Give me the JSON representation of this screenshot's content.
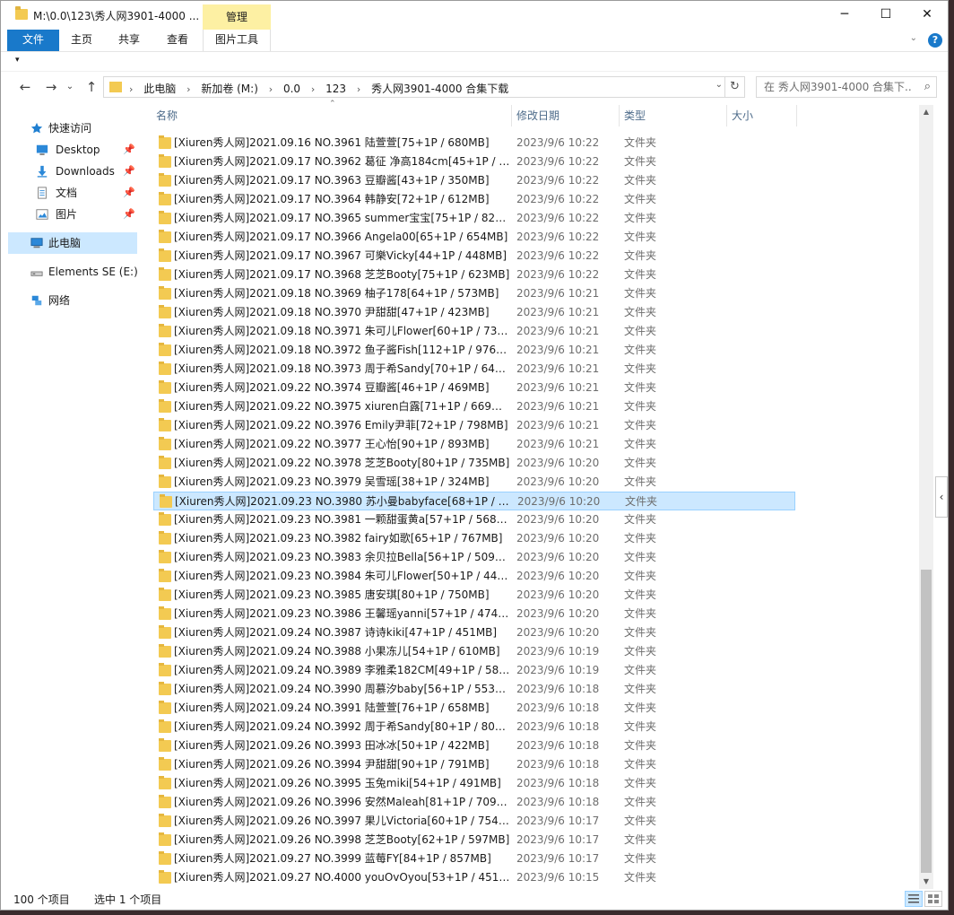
{
  "window": {
    "title": "M:\\0.0\\123\\秀人网3901-4000 ...",
    "context_tab_header": "管理",
    "minimize_glyph": "─",
    "maximize_glyph": "☐",
    "close_glyph": "✕"
  },
  "ribbon": {
    "tabs": [
      "文件",
      "主页",
      "共享",
      "查看",
      "图片工具"
    ],
    "expand_glyph": "⌄",
    "help_glyph": "?"
  },
  "qat": {
    "glyph": "▾"
  },
  "nav_buttons": {
    "back": "←",
    "forward": "→",
    "recent": "⌄",
    "up": "↑"
  },
  "address": {
    "crumbs": [
      "此电脑",
      "新加卷 (M:)",
      "0.0",
      "123",
      "秀人网3901-4000 合集下载"
    ],
    "separator": "›",
    "dropdown_glyph": "⌄",
    "refresh_glyph": "↻"
  },
  "search": {
    "placeholder": "在 秀人网3901-4000 合集下...",
    "icon": "⌕"
  },
  "nav_pane": [
    {
      "label": "快速访问",
      "icon": "star-icon",
      "pinned": false,
      "selected": false
    },
    {
      "label": "Desktop",
      "icon": "desktop-icon",
      "pinned": true,
      "selected": false
    },
    {
      "label": "Downloads",
      "icon": "download-icon",
      "pinned": true,
      "selected": false
    },
    {
      "label": "文档",
      "icon": "document-icon",
      "pinned": true,
      "selected": false
    },
    {
      "label": "图片",
      "icon": "picture-icon",
      "pinned": true,
      "selected": false
    },
    {
      "label": "此电脑",
      "icon": "computer-icon",
      "pinned": false,
      "selected": true
    },
    {
      "label": "Elements SE (E:)",
      "icon": "drive-icon",
      "pinned": false,
      "selected": false
    },
    {
      "label": "网络",
      "icon": "network-icon",
      "pinned": false,
      "selected": false
    }
  ],
  "columns": {
    "name": "名称",
    "date": "修改日期",
    "type": "类型",
    "size": "大小"
  },
  "rows": [
    {
      "name": "[Xiuren秀人网]2021.09.16 NO.3961 陆萱萱[75+1P / 680MB]",
      "date": "2023/9/6 10:22",
      "type": "文件夹"
    },
    {
      "name": "[Xiuren秀人网]2021.09.17 NO.3962 葛征 净高184cm[45+1P / 50...",
      "date": "2023/9/6 10:22",
      "type": "文件夹"
    },
    {
      "name": "[Xiuren秀人网]2021.09.17 NO.3963 豆瓣酱[43+1P / 350MB]",
      "date": "2023/9/6 10:22",
      "type": "文件夹"
    },
    {
      "name": "[Xiuren秀人网]2021.09.17 NO.3964 韩静安[72+1P / 612MB]",
      "date": "2023/9/6 10:22",
      "type": "文件夹"
    },
    {
      "name": "[Xiuren秀人网]2021.09.17 NO.3965 summer宝宝[75+1P / 823M...",
      "date": "2023/9/6 10:22",
      "type": "文件夹"
    },
    {
      "name": "[Xiuren秀人网]2021.09.17 NO.3966 Angela00[65+1P / 654MB]",
      "date": "2023/9/6 10:22",
      "type": "文件夹"
    },
    {
      "name": "[Xiuren秀人网]2021.09.17 NO.3967 可樂Vicky[44+1P / 448MB]",
      "date": "2023/9/6 10:22",
      "type": "文件夹"
    },
    {
      "name": "[Xiuren秀人网]2021.09.17 NO.3968 芝芝Booty[75+1P / 623MB]",
      "date": "2023/9/6 10:22",
      "type": "文件夹"
    },
    {
      "name": "[Xiuren秀人网]2021.09.18 NO.3969 柚子178[64+1P / 573MB]",
      "date": "2023/9/6 10:21",
      "type": "文件夹"
    },
    {
      "name": "[Xiuren秀人网]2021.09.18 NO.3970 尹甜甜[47+1P / 423MB]",
      "date": "2023/9/6 10:21",
      "type": "文件夹"
    },
    {
      "name": "[Xiuren秀人网]2021.09.18 NO.3971 朱可儿Flower[60+1P / 733...",
      "date": "2023/9/6 10:21",
      "type": "文件夹"
    },
    {
      "name": "[Xiuren秀人网]2021.09.18 NO.3972 鱼子酱Fish[112+1P / 976MB]",
      "date": "2023/9/6 10:21",
      "type": "文件夹"
    },
    {
      "name": "[Xiuren秀人网]2021.09.18 NO.3973 周于希Sandy[70+1P / 646M...",
      "date": "2023/9/6 10:21",
      "type": "文件夹"
    },
    {
      "name": "[Xiuren秀人网]2021.09.22 NO.3974 豆瓣酱[46+1P / 469MB]",
      "date": "2023/9/6 10:21",
      "type": "文件夹"
    },
    {
      "name": "[Xiuren秀人网]2021.09.22 NO.3975 xiuren白露[71+1P / 669MB]",
      "date": "2023/9/6 10:21",
      "type": "文件夹"
    },
    {
      "name": "[Xiuren秀人网]2021.09.22 NO.3976 Emily尹菲[72+1P / 798MB]",
      "date": "2023/9/6 10:21",
      "type": "文件夹"
    },
    {
      "name": "[Xiuren秀人网]2021.09.22 NO.3977 王心怡[90+1P / 893MB]",
      "date": "2023/9/6 10:21",
      "type": "文件夹"
    },
    {
      "name": "[Xiuren秀人网]2021.09.22 NO.3978 芝芝Booty[80+1P / 735MB]",
      "date": "2023/9/6 10:20",
      "type": "文件夹"
    },
    {
      "name": "[Xiuren秀人网]2021.09.23 NO.3979 吴雪瑶[38+1P / 324MB]",
      "date": "2023/9/6 10:20",
      "type": "文件夹"
    },
    {
      "name": "[Xiuren秀人网]2021.09.23 NO.3980 苏小曼babyface[68+1P / 63...",
      "date": "2023/9/6 10:20",
      "type": "文件夹",
      "selected": true
    },
    {
      "name": "[Xiuren秀人网]2021.09.23 NO.3981 一颗甜蛋黄a[57+1P / 568MB]",
      "date": "2023/9/6 10:20",
      "type": "文件夹"
    },
    {
      "name": "[Xiuren秀人网]2021.09.23 NO.3982 fairy如歌[65+1P / 767MB]",
      "date": "2023/9/6 10:20",
      "type": "文件夹"
    },
    {
      "name": "[Xiuren秀人网]2021.09.23 NO.3983 余贝拉Bella[56+1P / 509MB]",
      "date": "2023/9/6 10:20",
      "type": "文件夹"
    },
    {
      "name": "[Xiuren秀人网]2021.09.23 NO.3984 朱可儿Flower[50+1P / 445...",
      "date": "2023/9/6 10:20",
      "type": "文件夹"
    },
    {
      "name": "[Xiuren秀人网]2021.09.23 NO.3985 唐安琪[80+1P / 750MB]",
      "date": "2023/9/6 10:20",
      "type": "文件夹"
    },
    {
      "name": "[Xiuren秀人网]2021.09.23 NO.3986 王馨瑶yanni[57+1P / 474MB]",
      "date": "2023/9/6 10:20",
      "type": "文件夹"
    },
    {
      "name": "[Xiuren秀人网]2021.09.24 NO.3987 诗诗kiki[47+1P / 451MB]",
      "date": "2023/9/6 10:20",
      "type": "文件夹"
    },
    {
      "name": "[Xiuren秀人网]2021.09.24 NO.3988 小果冻儿[54+1P / 610MB]",
      "date": "2023/9/6 10:19",
      "type": "文件夹"
    },
    {
      "name": "[Xiuren秀人网]2021.09.24 NO.3989 李雅柔182CM[49+1P / 582...",
      "date": "2023/9/6 10:19",
      "type": "文件夹"
    },
    {
      "name": "[Xiuren秀人网]2021.09.24 NO.3990 周慕汐baby[56+1P / 553MB]",
      "date": "2023/9/6 10:18",
      "type": "文件夹"
    },
    {
      "name": "[Xiuren秀人网]2021.09.24 NO.3991 陆萱萱[76+1P / 658MB]",
      "date": "2023/9/6 10:18",
      "type": "文件夹"
    },
    {
      "name": "[Xiuren秀人网]2021.09.24 NO.3992 周于希Sandy[80+1P / 804M...",
      "date": "2023/9/6 10:18",
      "type": "文件夹"
    },
    {
      "name": "[Xiuren秀人网]2021.09.26 NO.3993 田冰冰[50+1P / 422MB]",
      "date": "2023/9/6 10:18",
      "type": "文件夹"
    },
    {
      "name": "[Xiuren秀人网]2021.09.26 NO.3994 尹甜甜[90+1P / 791MB]",
      "date": "2023/9/6 10:18",
      "type": "文件夹"
    },
    {
      "name": "[Xiuren秀人网]2021.09.26 NO.3995 玉兔miki[54+1P / 491MB]",
      "date": "2023/9/6 10:18",
      "type": "文件夹"
    },
    {
      "name": "[Xiuren秀人网]2021.09.26 NO.3996 安然Maleah[81+1P / 709MB]",
      "date": "2023/9/6 10:18",
      "type": "文件夹"
    },
    {
      "name": "[Xiuren秀人网]2021.09.26 NO.3997 果儿Victoria[60+1P / 754MB]",
      "date": "2023/9/6 10:17",
      "type": "文件夹"
    },
    {
      "name": "[Xiuren秀人网]2021.09.26 NO.3998 芝芝Booty[62+1P / 597MB]",
      "date": "2023/9/6 10:17",
      "type": "文件夹"
    },
    {
      "name": "[Xiuren秀人网]2021.09.27 NO.3999 蓝莓FY[84+1P / 857MB]",
      "date": "2023/9/6 10:17",
      "type": "文件夹"
    },
    {
      "name": "[Xiuren秀人网]2021.09.27 NO.4000 youOvOyou[53+1P / 451MB]",
      "date": "2023/9/6 10:15",
      "type": "文件夹"
    }
  ],
  "scrollbar": {
    "up": "▲",
    "down": "▼"
  },
  "side_handle": "‹",
  "status": {
    "item_count": "100 个项目",
    "selection": "选中 1 个项目"
  },
  "colors": {
    "accent": "#1979ca",
    "selection": "#cce8ff",
    "selection_border": "#99d1ff",
    "folder": "#f3ca52",
    "context_tab": "#fdf0a3"
  }
}
